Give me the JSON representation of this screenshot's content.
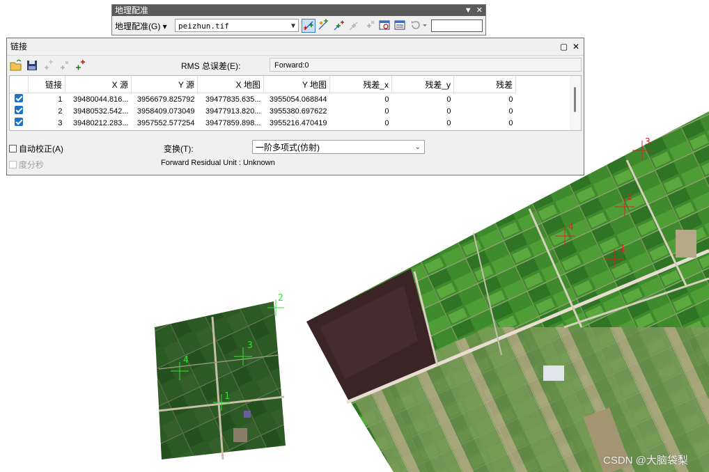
{
  "georef_toolbar": {
    "title": "地理配准",
    "menu_label": "地理配准(G)",
    "layer_value": "peizhun.tif",
    "icons": [
      "add-control-points-icon",
      "auto-adjust-icon",
      "select-link-icon",
      "zoom-to-selected-link-icon",
      "delete-link-icon",
      "viewer-icon",
      "view-link-table-icon",
      "rotate-icon"
    ],
    "scale_value": ""
  },
  "links_dialog": {
    "title": "链接",
    "rms_label": "RMS 总误差(E):",
    "rms_value": "Forward:0",
    "columns": [
      "链接",
      "X 源",
      "Y 源",
      "X 地图",
      "Y 地图",
      "残差_x",
      "残差_y",
      "残差"
    ],
    "rows": [
      {
        "id": "1",
        "x_src": "39480044.816...",
        "y_src": "3956679.825792",
        "x_map": "39477835.635...",
        "y_map": "3955054.068844",
        "res_x": "0",
        "res_y": "0",
        "res": "0"
      },
      {
        "id": "2",
        "x_src": "39480532.542...",
        "y_src": "3958409.073049",
        "x_map": "39477913.820...",
        "y_map": "3955380.697622",
        "res_x": "0",
        "res_y": "0",
        "res": "0"
      },
      {
        "id": "3",
        "x_src": "39480212.283...",
        "y_src": "3957552.577254",
        "x_map": "39477859.898...",
        "y_map": "3955216.470419",
        "res_x": "0",
        "res_y": "0",
        "res": "0"
      }
    ],
    "auto_adjust_label": "自动校正(A)",
    "dms_label": "度分秒",
    "transform_label": "变换(T):",
    "transform_value": "一阶多项式(仿射)",
    "residual_unit": "Forward Residual Unit : Unknown"
  },
  "map": {
    "source_points": [
      "1",
      "2",
      "3",
      "4"
    ],
    "target_points": [
      "1",
      "2",
      "3",
      "4"
    ],
    "source_color": "#33e033",
    "target_color": "#e02020"
  },
  "watermark": "CSDN @大脑袋梨"
}
